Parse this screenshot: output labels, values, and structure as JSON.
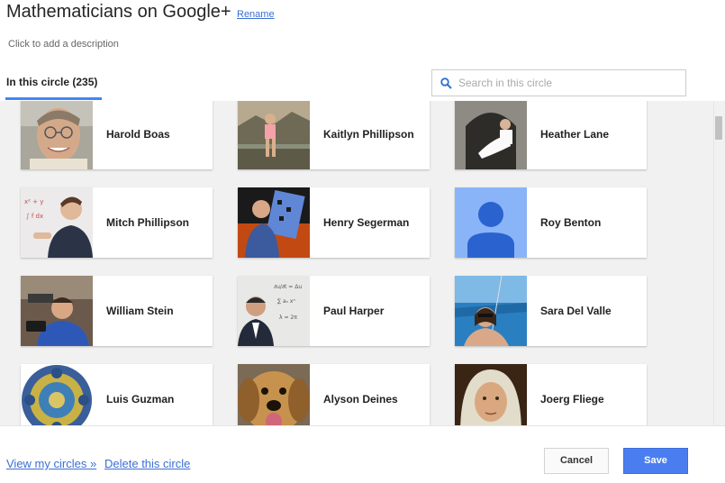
{
  "header": {
    "title": "Mathematicians on Google+",
    "rename_label": "Rename",
    "description_placeholder": "Click to add a description",
    "tab_label": "In this circle (235)"
  },
  "search": {
    "placeholder": "Search in this circle",
    "value": ""
  },
  "members": [
    {
      "name": "Harold Boas"
    },
    {
      "name": "Kaitlyn Phillipson"
    },
    {
      "name": "Heather Lane"
    },
    {
      "name": "Mitch Phillipson"
    },
    {
      "name": "Henry Segerman"
    },
    {
      "name": "Roy Benton"
    },
    {
      "name": "William Stein"
    },
    {
      "name": "Paul Harper"
    },
    {
      "name": "Sara Del Valle"
    },
    {
      "name": "Luis Guzman"
    },
    {
      "name": "Alyson Deines"
    },
    {
      "name": "Joerg Fliege"
    }
  ],
  "footer": {
    "view_circles_label": "View my circles »",
    "delete_circle_label": "Delete this circle",
    "cancel_label": "Cancel",
    "save_label": "Save"
  },
  "colors": {
    "accent": "#4285f4",
    "link": "#3b6fd4",
    "save_button": "#4a7ef0",
    "grid_background": "#f1f1f1"
  }
}
